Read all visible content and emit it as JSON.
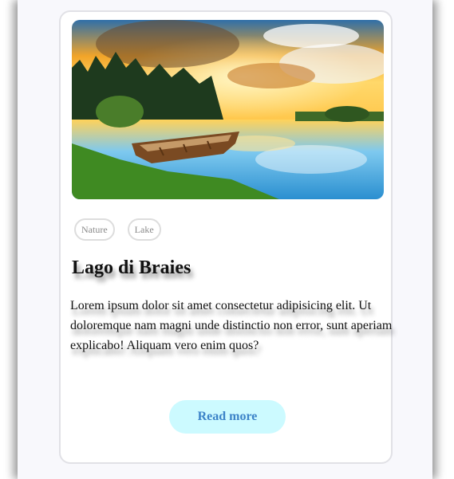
{
  "card": {
    "image_alt": "Boat on lake at sunset",
    "tags": [
      "Nature",
      "Lake"
    ],
    "title": "Lago di Braies",
    "description": "Lorem ipsum dolor sit amet consectetur adipisicing elit. Ut doloremque nam magni unde distinctio non error, sunt aperiam explicabo! Aliquam vero enim quos?",
    "button_label": "Read more"
  },
  "colors": {
    "button_bg": "#ccfaff",
    "button_text": "#3c83c8",
    "tag_border": "#dddddd",
    "card_border": "#e1e1e6"
  }
}
